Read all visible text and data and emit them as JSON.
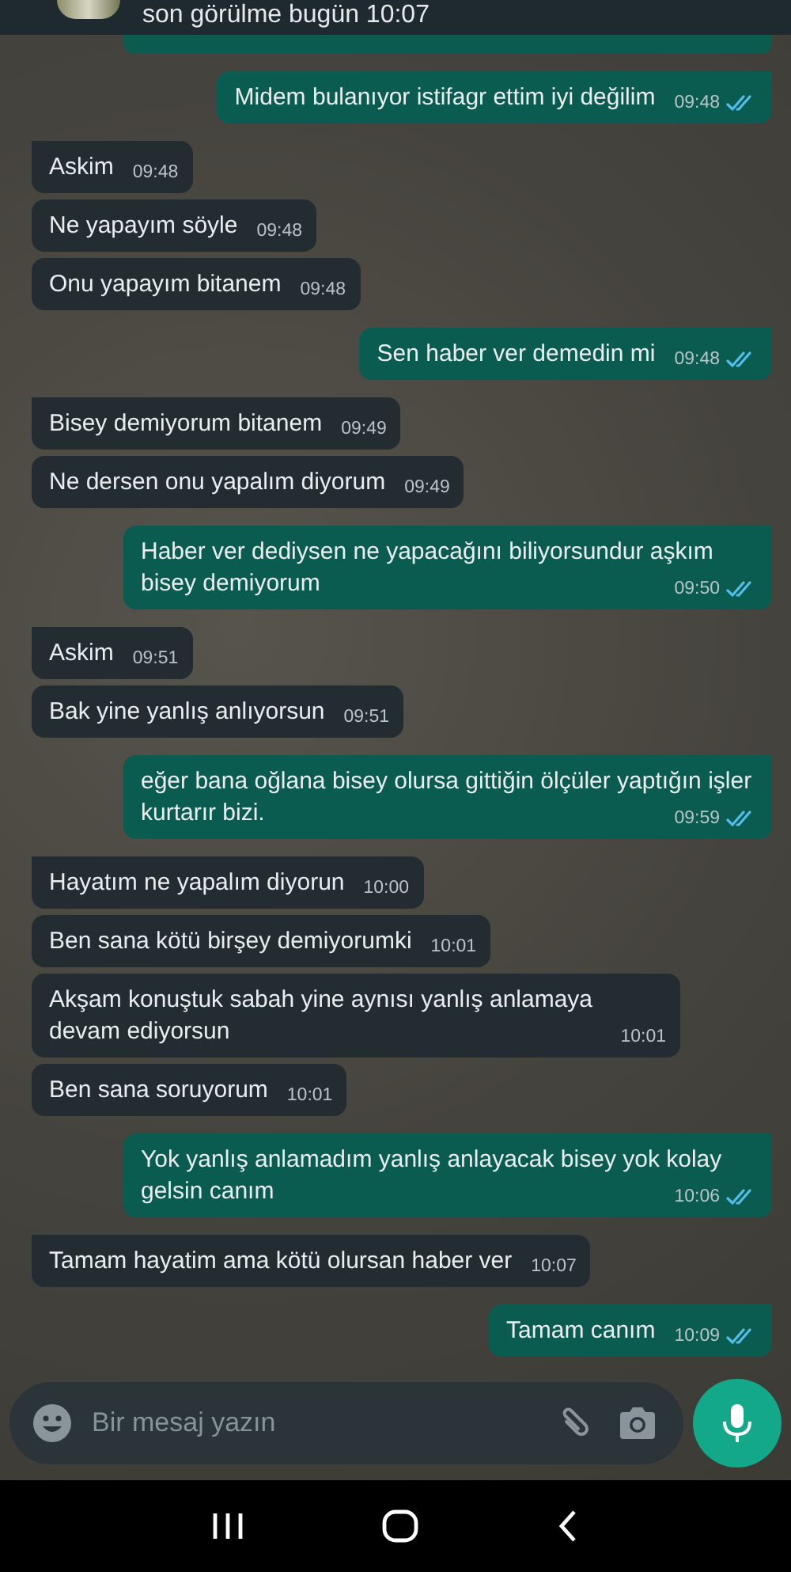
{
  "header": {
    "status": "son görülme bugün 10:07"
  },
  "messages": [
    {
      "kind": "outgoing",
      "group_start": true,
      "text": "Midem bulanıyor istifagr ettim iyi değilim",
      "time": "09:48",
      "read": true
    },
    {
      "kind": "incoming",
      "group_start": true,
      "text": "Askim",
      "time": "09:48"
    },
    {
      "kind": "incoming",
      "group_start": false,
      "text": "Ne yapayım söyle",
      "time": "09:48"
    },
    {
      "kind": "incoming",
      "group_start": false,
      "text": "Onu yapayım bitanem",
      "time": "09:48"
    },
    {
      "kind": "outgoing",
      "group_start": true,
      "text": "Sen haber ver demedin mi",
      "time": "09:48",
      "read": true
    },
    {
      "kind": "incoming",
      "group_start": true,
      "text": "Bisey demiyorum bitanem",
      "time": "09:49"
    },
    {
      "kind": "incoming",
      "group_start": false,
      "text": "Ne dersen onu yapalım diyorum",
      "time": "09:49"
    },
    {
      "kind": "outgoing",
      "group_start": true,
      "text": "Haber ver dediysen ne yapacağını biliyorsundur aşkım bisey demiyorum",
      "time": "09:50",
      "read": true
    },
    {
      "kind": "incoming",
      "group_start": true,
      "text": "Askim",
      "time": "09:51"
    },
    {
      "kind": "incoming",
      "group_start": false,
      "text": "Bak yine yanlış anlıyorsun",
      "time": "09:51"
    },
    {
      "kind": "outgoing",
      "group_start": true,
      "text": "eğer bana oğlana bisey olursa gittiğin ölçüler yaptığın işler kurtarır bizi.",
      "time": "09:59",
      "read": true
    },
    {
      "kind": "incoming",
      "group_start": true,
      "text": "Hayatım ne yapalım diyorun",
      "time": "10:00"
    },
    {
      "kind": "incoming",
      "group_start": false,
      "text": "Ben sana kötü birşey demiyorumki",
      "time": "10:01"
    },
    {
      "kind": "incoming",
      "group_start": false,
      "text": "Akşam konuştuk sabah yine aynısı yanlış anlamaya devam ediyorsun",
      "time": "10:01"
    },
    {
      "kind": "incoming",
      "group_start": false,
      "text": "Ben sana soruyorum",
      "time": "10:01"
    },
    {
      "kind": "outgoing",
      "group_start": true,
      "text": "Yok yanlış anlamadım yanlış anlayacak bisey yok kolay gelsin canım",
      "time": "10:06",
      "read": true
    },
    {
      "kind": "incoming",
      "group_start": true,
      "text": "Tamam hayatim ama kötü olursan haber ver",
      "time": "10:07"
    },
    {
      "kind": "outgoing",
      "group_start": true,
      "text": "Tamam canım",
      "time": "10:09",
      "read": true
    }
  ],
  "composer": {
    "placeholder": "Bir mesaj yazın"
  }
}
